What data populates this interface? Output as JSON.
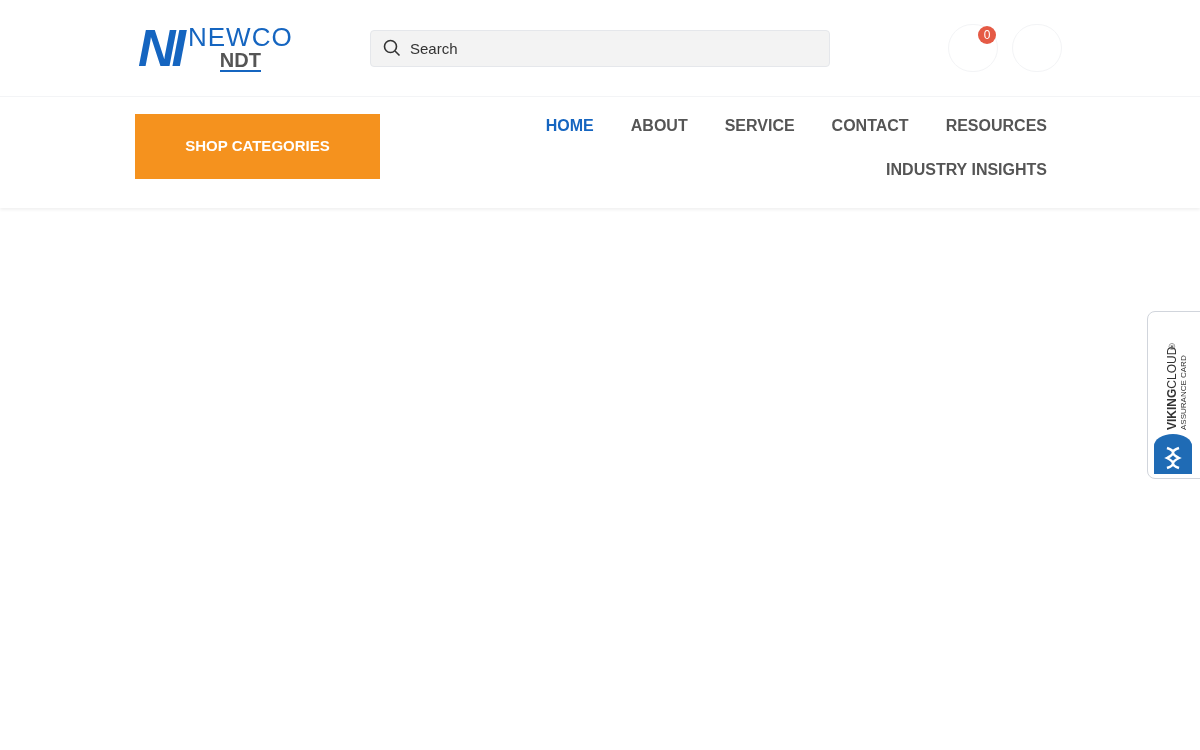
{
  "logo": {
    "mark": "NI",
    "name": "NEWCO",
    "sub": "NDT"
  },
  "search": {
    "placeholder": "Search"
  },
  "cart": {
    "count": "0"
  },
  "shop_button": "SHOP CATEGORIES",
  "nav": [
    {
      "label": "HOME",
      "selected": true
    },
    {
      "label": "ABOUT",
      "selected": false
    },
    {
      "label": "SERVICE",
      "selected": false
    },
    {
      "label": "CONTACT",
      "selected": false
    },
    {
      "label": "RESOURCES",
      "selected": false
    },
    {
      "label": "INDUSTRY INSIGHTS",
      "selected": false
    }
  ],
  "badge": {
    "brand_bold": "VIKING",
    "brand_light": "CLOUD",
    "mark": "®",
    "caption": "ASSURANCE CARD"
  }
}
